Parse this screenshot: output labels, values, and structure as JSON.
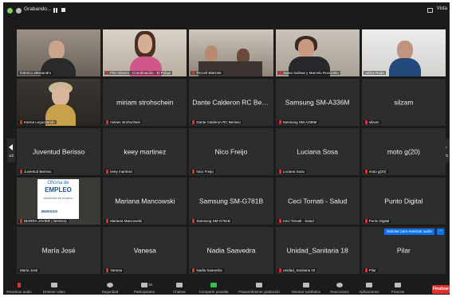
{
  "recording": {
    "label": "Grabando..."
  },
  "view": {
    "label": "Vista"
  },
  "page": {
    "current": 1,
    "total": 2,
    "label": "1/2"
  },
  "tiles": [
    {
      "label": "federico alessandro",
      "video": true,
      "active": true
    },
    {
      "label": "Flor Alvarez - Coordinación - El Pulqui",
      "video": true
    },
    {
      "label": "Tezzeli-Bitezmk",
      "video": true
    },
    {
      "label": "Juana Salinas y Marcelo Roscioleo",
      "video": true
    },
    {
      "label": "carlos Rada",
      "video": true
    },
    {
      "label": "Karina Leguizamón",
      "video": true
    },
    {
      "name": "miriam strohschein",
      "label": "miriam strohschein"
    },
    {
      "name": "Dante Calderon RC Berisso",
      "label": "Dante Calderon RC Berisso"
    },
    {
      "name": "Samsung SM-A336M",
      "label": "Samsung SM-A336M"
    },
    {
      "name": "silzam",
      "label": "silzam"
    },
    {
      "name": "Juventud Berisso",
      "label": "Juventud Berisso"
    },
    {
      "name": "keey martinez",
      "label": "keey martinez"
    },
    {
      "name": "Nico Freijo",
      "label": "Nico Freijo"
    },
    {
      "name": "Luciana Sosa",
      "label": "Luciana Sosa"
    },
    {
      "name": "moto g(20)",
      "label": "moto g(20)"
    },
    {
      "label": "IBARRA JAVIER ( Berisso)",
      "video": true,
      "poster": {
        "line1": "Oficina de",
        "line2": "EMPLEO",
        "line3": "MINISTERIO DE TRABAJO",
        "line4": "BERISSO"
      }
    },
    {
      "name": "Mariana Mancowski",
      "label": "Mariana Mancowski"
    },
    {
      "name": "Samsung SM-G781B",
      "label": "Samsung SM-G781B"
    },
    {
      "name": "Ceci Tornati - Salud",
      "label": "Ceci Tornati - Salud"
    },
    {
      "name": "Punto Digital",
      "label": "Punto Digital"
    },
    {
      "name": "María José",
      "label": "María José"
    },
    {
      "name": "Vanesa",
      "label": "Vanesa"
    },
    {
      "name": "Nadia Saavedra",
      "label": "Nadia Saavedra"
    },
    {
      "name": "Unidad_Sanitaria 18",
      "label": "Unidad_Sanitaria 18"
    },
    {
      "name": "Pilar",
      "label": "Pilar",
      "overlay_button": "Solicitar para reactivar audio",
      "more": "···"
    }
  ],
  "toolbar": {
    "items": [
      {
        "label": "Reactivar audio",
        "icon": "microphone-muted-icon"
      },
      {
        "label": "Detener video",
        "icon": "video-camera-icon"
      },
      {
        "label": "Seguridad",
        "icon": "shield-icon"
      },
      {
        "label": "Participantes",
        "icon": "participants-icon",
        "count": "35"
      },
      {
        "label": "Chatear",
        "icon": "chat-icon"
      },
      {
        "label": "Compartir pantalla",
        "icon": "share-screen-icon"
      },
      {
        "label": "Pausar/detener grabación",
        "icon": "pause-recording-icon"
      },
      {
        "label": "Mostrar subtítulos",
        "icon": "captions-icon"
      },
      {
        "label": "Reacciones",
        "icon": "reactions-icon"
      },
      {
        "label": "Aplicaciones",
        "icon": "apps-icon"
      },
      {
        "label": "Pizarras",
        "icon": "whiteboard-icon"
      }
    ],
    "end_label": "Finalizar"
  },
  "colors": {
    "accent": "#0e72ed",
    "active_border": "#49c832",
    "end": "#e0312b",
    "share": "#2fbf4a",
    "muted": "#e0312b"
  }
}
